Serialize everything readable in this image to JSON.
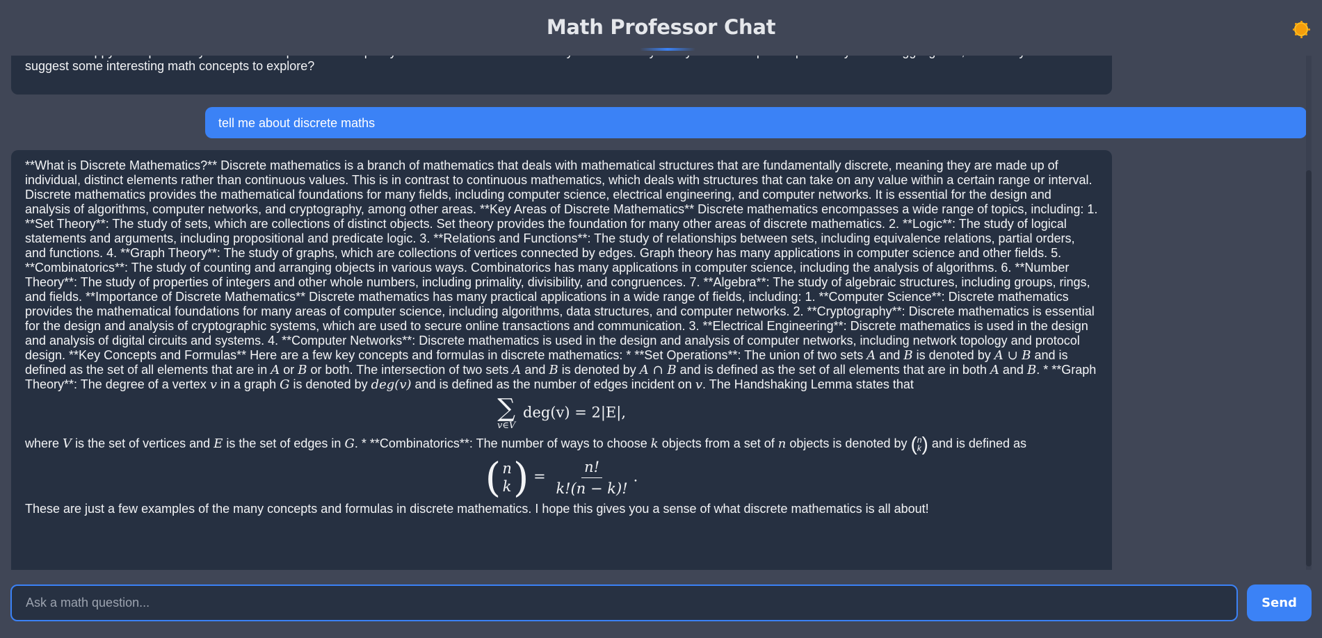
{
  "header": {
    "title": "Math Professor Chat",
    "theme_icon": "sun-icon"
  },
  "messages": [
    {
      "role": "assistant",
      "text": "Hello! I'm happy to help with any math-related questions or topics you'd like to discuss. What's on your mind today? Do you have a specific problem you're struggling with, or would you like me to suggest some interesting math concepts to explore?"
    },
    {
      "role": "user",
      "text": "tell me about discrete maths"
    },
    {
      "role": "assistant",
      "paragraph_1": "**What is Discrete Mathematics?** Discrete mathematics is a branch of mathematics that deals with mathematical structures that are fundamentally discrete, meaning they are made up of individual, distinct elements rather than continuous values. This is in contrast to continuous mathematics, which deals with structures that can take on any value within a certain range or interval. Discrete mathematics provides the mathematical foundations for many fields, including computer science, electrical engineering, and computer networks. It is essential for the design and analysis of algorithms, computer networks, and cryptography, among other areas. **Key Areas of Discrete Mathematics** Discrete mathematics encompasses a wide range of topics, including: 1. **Set Theory**: The study of sets, which are collections of distinct objects. Set theory provides the foundation for many other areas of discrete mathematics. 2. **Logic**: The study of logical statements and arguments, including propositional and predicate logic. 3. **Relations and Functions**: The study of relationships between sets, including equivalence relations, partial orders, and functions. 4. **Graph Theory**: The study of graphs, which are collections of vertices connected by edges. Graph theory has many applications in computer science and other fields. 5. **Combinatorics**: The study of counting and arranging objects in various ways. Combinatorics has many applications in computer science, including the analysis of algorithms. 6. **Number Theory**: The study of properties of integers and other whole numbers, including primality, divisibility, and congruences. 7. **Algebra**: The study of algebraic structures, including groups, rings, and fields. **Importance of Discrete Mathematics** Discrete mathematics has many practical applications in a wide range of fields, including: 1. **Computer Science**: Discrete mathematics provides the mathematical foundations for many areas of computer science, including algorithms, data structures, and computer networks. 2. **Cryptography**: Discrete mathematics is essential for the design and analysis of cryptographic systems, which are used to secure online transactions and communication. 3. **Electrical Engineering**: Discrete mathematics is used in the design and analysis of digital circuits and systems. 4. **Computer Networks**: Discrete mathematics is used in the design and analysis of computer networks, including network topology and protocol design. **Key Concepts and Formulas** Here are a few key concepts and formulas in discrete mathematics: * **Set Operations**: The union of two sets",
      "p1_t1": "and",
      "p1_t2": "is denoted by",
      "p1_t3": "and is defined as the set of all elements that are in",
      "p1_t4": "or",
      "p1_t5": "or both. The intersection of two sets",
      "p1_t6": "and",
      "p1_t7": "is denoted by",
      "p1_t8": "and is defined as the set of all elements that are in both",
      "p1_t9": "and",
      "p1_t10": ". * **Graph Theory**: The degree of a vertex",
      "p1_t11": "in a graph",
      "p1_t12": "is denoted by",
      "p1_t13": "and is defined as the number of edges incident on",
      "p1_t14": ". The Handshaking Lemma states that",
      "p2_t1": "where",
      "p2_t2": "is the set of vertices and",
      "p2_t3": "is the set of edges in",
      "p2_t4": ". * **Combinatorics**: The number of ways to choose",
      "p2_t5": "objects from a set of",
      "p2_t6": "objects is denoted by",
      "p2_t7": "and is defined as",
      "paragraph_3": "These are just a few examples of the many concepts and formulas in discrete mathematics. I hope this gives you a sense of what discrete mathematics is all about!",
      "math": {
        "A": "A",
        "B": "B",
        "union": "A ∪ B",
        "intersection": "A ∩ B",
        "v": "v",
        "G": "G",
        "deg_v": "deg(v)",
        "V": "V",
        "E": "E",
        "k": "k",
        "n": "n",
        "sum_sub": "v∈V",
        "sum_body": "deg(v) = 2|E|,",
        "binom_top": "n",
        "binom_bottom": "k",
        "frac_num": "n!",
        "frac_den": "k!(n − k)!"
      }
    }
  ],
  "input": {
    "placeholder": "Ask a math question...",
    "value": ""
  },
  "send_label": "Send"
}
